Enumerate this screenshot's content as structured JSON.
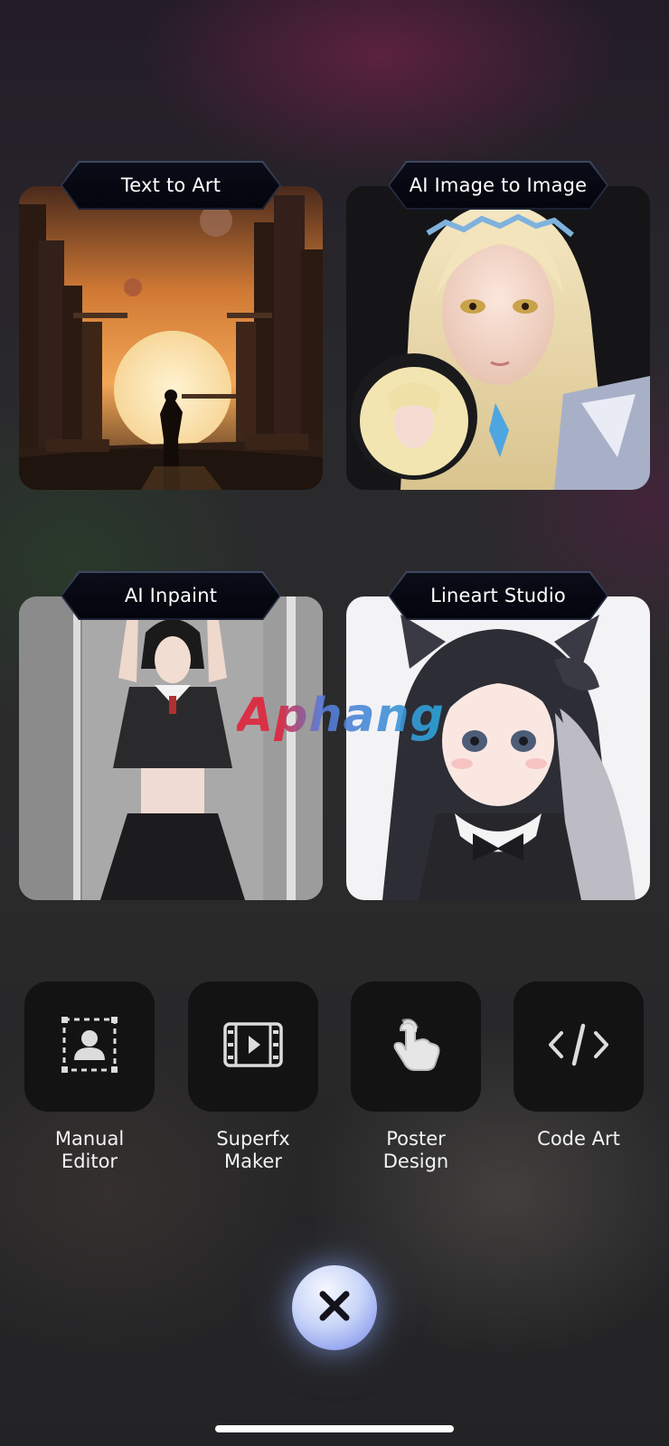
{
  "cards": [
    {
      "label": "Text to Art"
    },
    {
      "label": "AI Image to Image"
    },
    {
      "label": "AI Inpaint"
    },
    {
      "label": "Lineart Studio"
    }
  ],
  "watermark": {
    "text": "Aphang"
  },
  "tools": [
    {
      "label": "Manual Editor",
      "icon": "person-select-icon"
    },
    {
      "label": "Superfx Maker",
      "icon": "film-play-icon"
    },
    {
      "label": "Poster Design",
      "icon": "hand-tap-icon"
    },
    {
      "label": "Code Art",
      "icon": "code-icon"
    }
  ],
  "close_button": {
    "icon": "close-icon"
  },
  "colors": {
    "tile_background": "#131313",
    "close_button_glow": "#9aaaf0",
    "label_plate": "#0a0c18"
  }
}
